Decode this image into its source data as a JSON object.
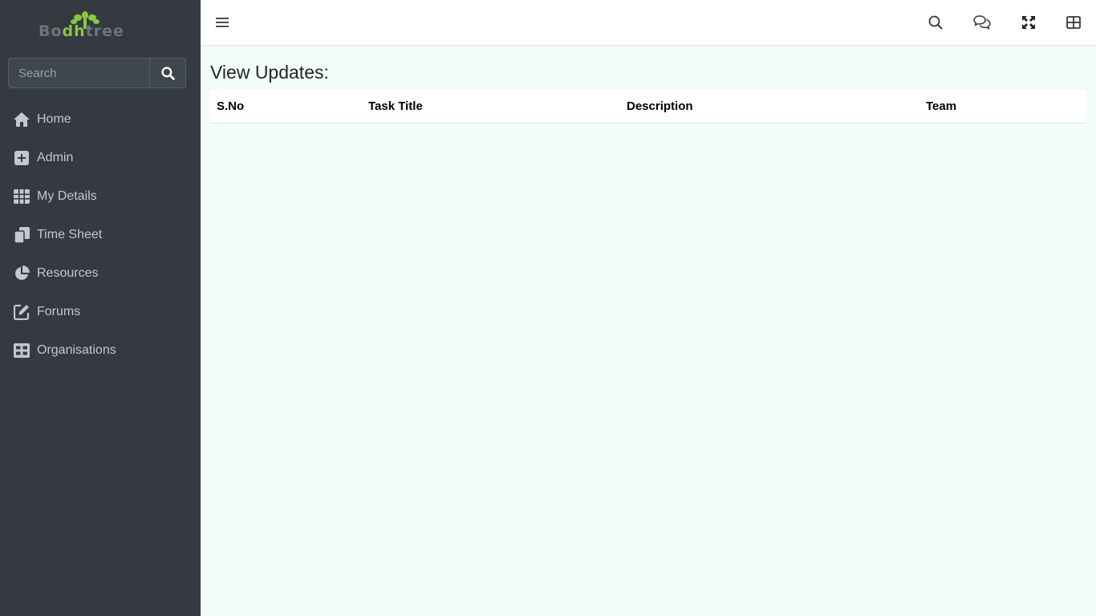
{
  "brand": {
    "logo_text_left": "Bo",
    "logo_text_mid": "dh",
    "logo_text_right": "tree"
  },
  "sidebar": {
    "search": {
      "placeholder": "Search"
    },
    "items": [
      {
        "label": "Home",
        "icon": "home-icon"
      },
      {
        "label": "Admin",
        "icon": "plus-square-icon"
      },
      {
        "label": "My Details",
        "icon": "table-icon"
      },
      {
        "label": "Time Sheet",
        "icon": "copy-icon"
      },
      {
        "label": "Resources",
        "icon": "chart-pie-icon"
      },
      {
        "label": "Forums",
        "icon": "edit-icon"
      },
      {
        "label": "Organisations",
        "icon": "th-large-icon"
      }
    ]
  },
  "topbar": {
    "icons": [
      "menu-icon",
      "search-icon",
      "comments-icon",
      "expand-icon",
      "grid-icon"
    ]
  },
  "main": {
    "title": "View Updates:",
    "table": {
      "columns": [
        "S.No",
        "Task Title",
        "Description",
        "Team"
      ],
      "rows": []
    }
  },
  "colors": {
    "sidebar_bg": "#343a40",
    "content_bg": "#f3fdf8",
    "logo_green": "#8cc63f"
  }
}
